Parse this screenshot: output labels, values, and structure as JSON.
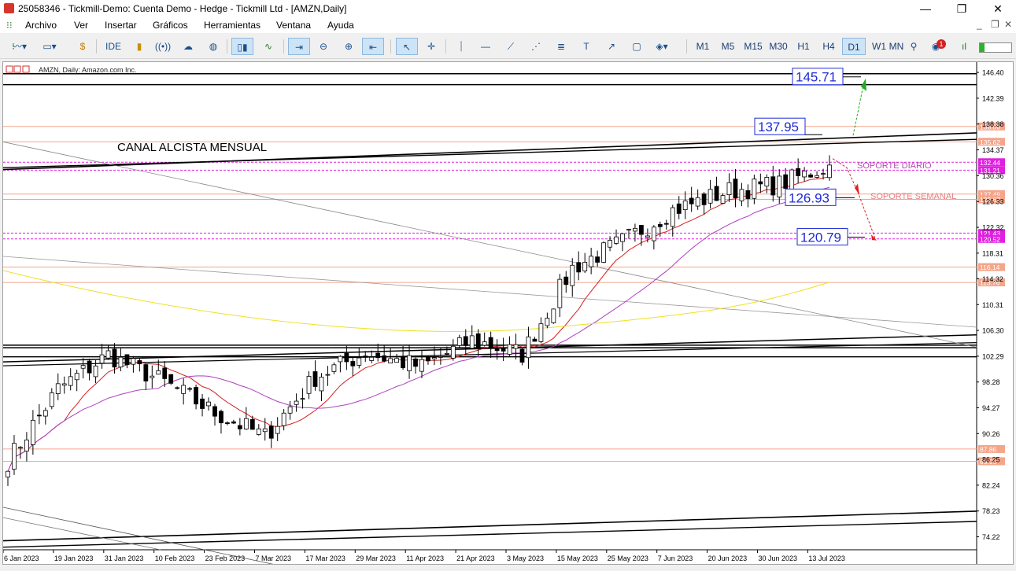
{
  "window": {
    "title": "25058346 - Tickmill-Demo: Cuenta Demo - Hedge - Tickmill Ltd - [AMZN,Daily]",
    "minimize_glyph": "—",
    "restore_glyph": "❐",
    "close_glyph": "✕"
  },
  "menu": {
    "items": [
      "Archivo",
      "Ver",
      "Insertar",
      "Gráficos",
      "Herramientas",
      "Ventana",
      "Ayuda"
    ],
    "inner_min": "_",
    "inner_restore": "❐",
    "inner_close": "✕"
  },
  "toolbar": {
    "ide_label": "IDE",
    "timeframes": [
      "M1",
      "M5",
      "M15",
      "M30",
      "H1",
      "H4",
      "D1",
      "W1",
      "MN"
    ],
    "active_timeframe": "D1",
    "notification_count": "1"
  },
  "chart": {
    "symbol_label": "AMZN, Daily:  Amazon.com Inc.",
    "annotation_channel": "CANAL ALCISTA MENSUAL",
    "annotation_support_daily": "SOPORTE DIARIO",
    "annotation_support_weekly": "SOPORTE SEMANAL",
    "boxed_levels": [
      "145.71",
      "137.95",
      "126.93",
      "120.79"
    ],
    "price_scale": [
      "146.40",
      "142.39",
      "138.38",
      "134.37",
      "130.36",
      "126.33",
      "122.32",
      "118.31",
      "114.32",
      "110.31",
      "106.30",
      "102.29",
      "98.28",
      "94.27",
      "90.26",
      "86.25",
      "82.24",
      "78.23",
      "74.22"
    ],
    "highlighted_prices": [
      {
        "text": "138.00",
        "color": "#f4a58a"
      },
      {
        "text": "135.62",
        "color": "#f4a58a"
      },
      {
        "text": "132.44",
        "color": "#e020e0"
      },
      {
        "text": "131.21",
        "color": "#e020e0"
      },
      {
        "text": "127.49",
        "color": "#f4a58a"
      },
      {
        "text": "126.67",
        "color": "#f4a58a"
      },
      {
        "text": "121.43",
        "color": "#e020e0"
      },
      {
        "text": "120.52",
        "color": "#e020e0"
      },
      {
        "text": "116.14",
        "color": "#f4a58a"
      },
      {
        "text": "113.76",
        "color": "#f4a58a"
      },
      {
        "text": "87.86",
        "color": "#f4a58a"
      },
      {
        "text": "85.96",
        "color": "#f4a58a"
      }
    ],
    "date_axis": [
      "6 Jan 2023",
      "19 Jan 2023",
      "31 Jan 2023",
      "10 Feb 2023",
      "23 Feb 2023",
      "7 Mar 2023",
      "17 Mar 2023",
      "29 Mar 2023",
      "11 Apr 2023",
      "21 Apr 2023",
      "3 May 2023",
      "15 May 2023",
      "25 May 2023",
      "7 Jun 2023",
      "20 Jun 2023",
      "30 Jun 2023",
      "13 Jul 2023"
    ],
    "colors": {
      "candle_up": "#ffffff",
      "candle_down": "#000000",
      "ma_fast": "#d81e1e",
      "ma_mid": "#b040c0",
      "ma_slow": "#f0e020",
      "salmon_level": "#f4a58a",
      "magenta_level": "#e020e0",
      "box_text": "#1f2bd6"
    }
  },
  "chart_data": {
    "type": "candlestick",
    "title": "AMZN, Daily:  Amazon.com Inc.",
    "ylim": [
      72.2,
      148.0
    ],
    "x": [
      "6 Jan 2023",
      "19 Jan 2023",
      "31 Jan 2023",
      "10 Feb 2023",
      "23 Feb 2023",
      "7 Mar 2023",
      "17 Mar 2023",
      "29 Mar 2023",
      "11 Apr 2023",
      "21 Apr 2023",
      "3 May 2023",
      "15 May 2023",
      "25 May 2023",
      "7 Jun 2023",
      "20 Jun 2023",
      "30 Jun 2023",
      "13 Jul 2023"
    ],
    "close": [
      86.0,
      97.2,
      102.5,
      98.2,
      93.5,
      89.8,
      99.0,
      102.8,
      100.6,
      104.8,
      102.6,
      116.0,
      120.1,
      125.0,
      128.0,
      129.0,
      132.0
    ]
  }
}
